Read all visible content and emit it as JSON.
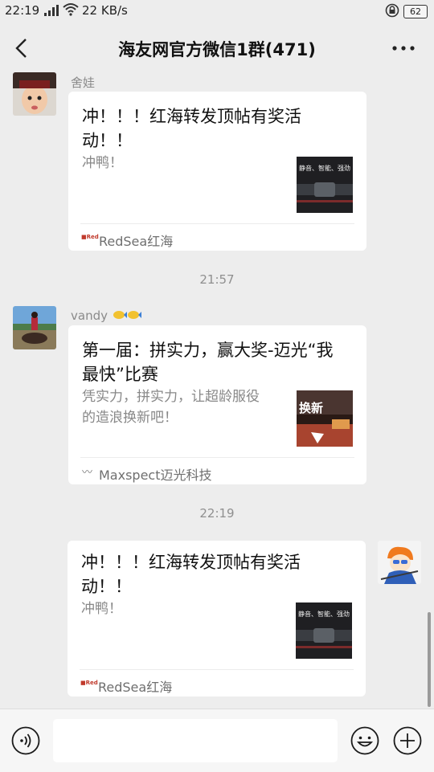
{
  "status": {
    "time": "22:19",
    "speed": "22 KB/s",
    "battery": "62"
  },
  "header": {
    "title": "海友网官方微信1群(471)"
  },
  "messages": [
    {
      "sender": "舍娃",
      "card_title_line1": "冲！！！红海转发顶帖有奖活",
      "card_title_line2": "动！！",
      "card_desc": "冲鸭！",
      "thumb_text": "静音、智能、强劲",
      "source": "RedSea红海"
    },
    {
      "sender": "vandy",
      "card_title_line1": "第一届：拼实力，赢大奖-迈光“我",
      "card_title_line2": "最快”比赛",
      "card_desc_line1": "凭实力，拼实力，让超龄服役",
      "card_desc_line2": "的造浪换新吧！",
      "thumb_text": "换新",
      "source": "Maxspect迈光科技"
    },
    {
      "card_title_line1": "冲！！！红海转发顶帖有奖活",
      "card_title_line2": "动！！",
      "card_desc": "冲鸭！",
      "thumb_text": "静音、智能、强劲",
      "source": "RedSea红海"
    }
  ],
  "timestamps": [
    "21:57",
    "22:19"
  ],
  "icons": {
    "back": "back-arrow-icon",
    "more": "more-dots-icon",
    "voice": "voice-icon",
    "emoji": "emoji-icon",
    "plus": "plus-icon"
  }
}
